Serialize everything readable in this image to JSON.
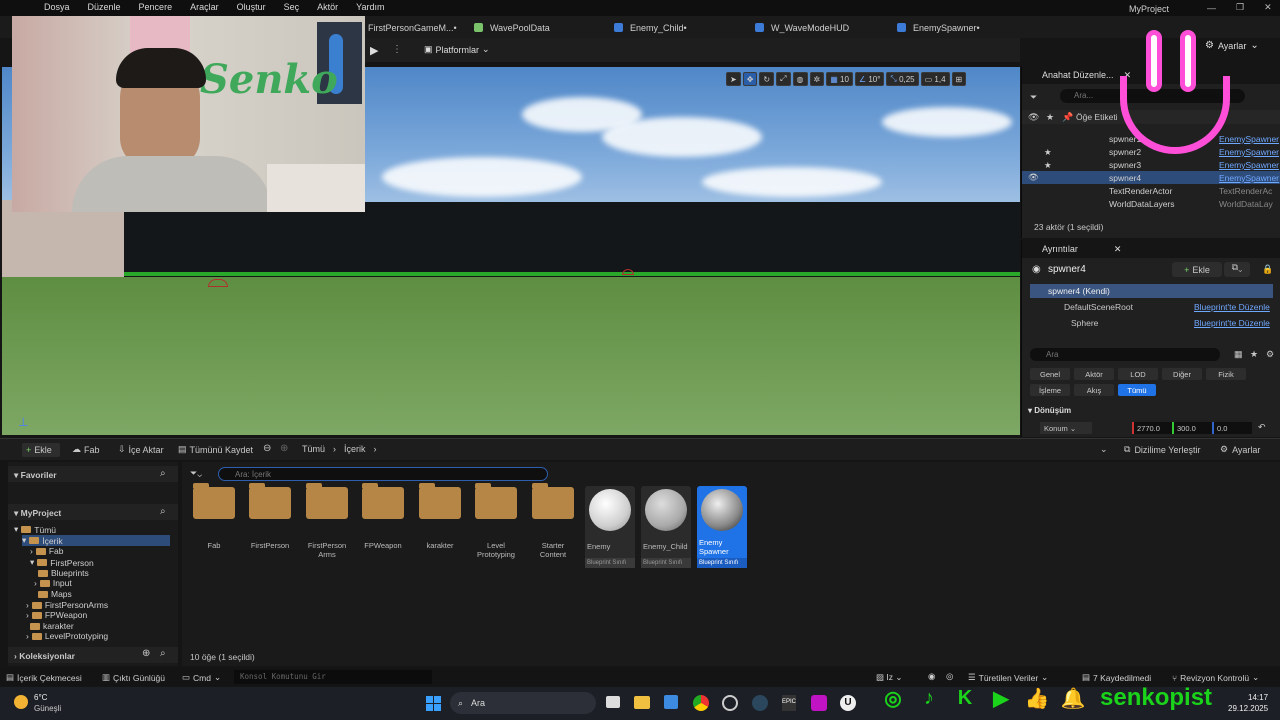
{
  "menu": [
    "Dosya",
    "Düzenle",
    "Pencere",
    "Araçlar",
    "Oluştur",
    "Seç",
    "Aktör",
    "Yardım"
  ],
  "project_name": "MyProject",
  "tabs": [
    {
      "label": "FirstPersonGameM...•",
      "color": "#6fa8ff"
    },
    {
      "label": "WavePoolData",
      "color": "#7ac36a"
    },
    {
      "label": "Enemy_Child•",
      "color": "#3d7bd8"
    },
    {
      "label": "W_WaveModeHUD",
      "color": "#3d7bd8"
    },
    {
      "label": "EnemySpawner•",
      "color": "#3d7bd8"
    }
  ],
  "toolbar": {
    "platforms": "Platformlar",
    "settings": "Ayarlar"
  },
  "viewport_tools": {
    "grid": "10",
    "angle": "10°",
    "scale": "0,25",
    "speed": "1,4"
  },
  "webcam": {
    "wall_text": "Senko"
  },
  "outliner": {
    "tab": "Anahat Düzenle...",
    "search": "Ara...",
    "column": "Öğe Etiketi",
    "rows": [
      {
        "name": "spwner1",
        "type": "EnemySpawner"
      },
      {
        "name": "spwner2",
        "type": "EnemySpawner"
      },
      {
        "name": "spwner3",
        "type": "EnemySpawner"
      },
      {
        "name": "spwner4",
        "type": "EnemySpawner"
      },
      {
        "name": "TextRenderActor",
        "type": "TextRenderAc"
      },
      {
        "name": "WorldDataLayers",
        "type": "WorldDataLay"
      }
    ],
    "count": "23 aktör (1 seçildi)"
  },
  "details": {
    "tab": "Ayrıntılar",
    "actor": "spwner4",
    "add": "Ekle",
    "self": "spwner4 (Kendi)",
    "components": [
      {
        "name": "DefaultSceneRoot",
        "link": "Blueprint'te Düzenle"
      },
      {
        "name": "Sphere",
        "link": "Blueprint'te Düzenle"
      }
    ],
    "search": "Ara",
    "cats_row1": [
      "Genel",
      "Aktör",
      "LOD",
      "Diğer",
      "Fizik"
    ],
    "cats_row2": [
      "İşleme",
      "Akış",
      "Tümü"
    ],
    "section": "Dönüşüm",
    "location_label": "Konum",
    "location": [
      "2770.0",
      "300.0",
      "0.0"
    ]
  },
  "content_browser": {
    "add": "Ekle",
    "fab": "Fab",
    "import": "İçe Aktar",
    "save_all": "Tümünü Kaydet",
    "breadcrumb": [
      "Tümü",
      "İçerik"
    ],
    "dock": "Dizilime Yerleştir",
    "settings": "Ayarlar",
    "favorites": "Favoriler",
    "project": "MyProject",
    "search": "Ara: İçerik",
    "tree": [
      "Tümü",
      "İçerik",
      "Fab",
      "FirstPerson",
      "Blueprints",
      "Input",
      "Maps",
      "FirstPersonArms",
      "FPWeapon",
      "karakter",
      "LevelPrototyping"
    ],
    "collections": "Koleksiyonlar",
    "folders": [
      "Fab",
      "FirstPerson",
      "FirstPerson Arms",
      "FPWeapon",
      "karakter",
      "Level Prototyping",
      "Starter Content"
    ],
    "blueprints": [
      {
        "name": "Enemy",
        "kind": "Blueprint Sınıfı"
      },
      {
        "name": "Enemy_Child",
        "kind": "Blueprint Sınıfı"
      },
      {
        "name": "Enemy Spawner",
        "kind": "Blueprint Sınıfı"
      }
    ],
    "item_count": "10 öğe (1 seçildi)"
  },
  "statusbar": {
    "drawer": "İçerik Çekmecesi",
    "log": "Çıktı Günlüğü",
    "cmd": "Cmd",
    "console_placeholder": "Konsol Komutunu Gir",
    "derived": "Türetilen Veriler",
    "saved": "7 Kaydedilmedi",
    "revision": "Revizyon Kontrolü"
  },
  "taskbar": {
    "temp": "6°C",
    "weather": "Güneşli",
    "search": "Ara",
    "time": "14:17",
    "date": "29.12.2025"
  },
  "social": {
    "handle": "senkopist"
  }
}
